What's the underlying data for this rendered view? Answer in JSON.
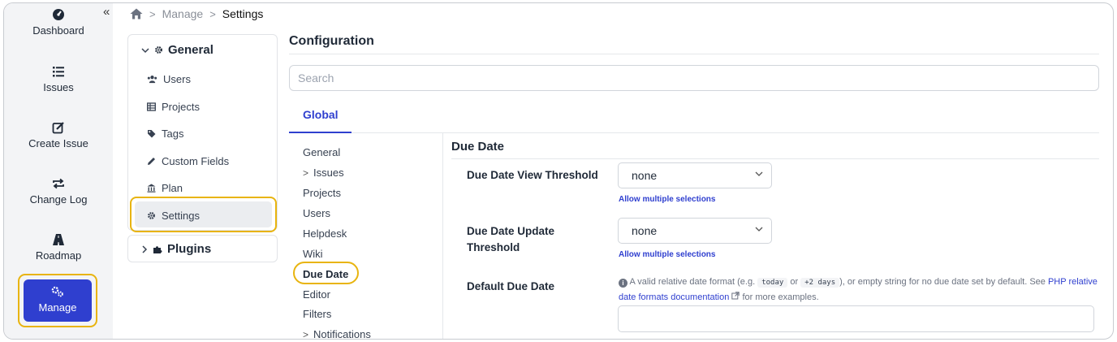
{
  "rail": {
    "collapse_icon": "«",
    "items": [
      {
        "label": "Dashboard",
        "icon": "dashboard-icon"
      },
      {
        "label": "Issues",
        "icon": "list-icon"
      },
      {
        "label": "Create Issue",
        "icon": "edit-icon"
      },
      {
        "label": "Change Log",
        "icon": "repeat-icon"
      },
      {
        "label": "Roadmap",
        "icon": "road-icon"
      },
      {
        "label": "Manage",
        "icon": "cogs-icon"
      }
    ]
  },
  "breadcrumb": {
    "home_icon": "home-icon",
    "items": [
      "Manage",
      "Settings"
    ]
  },
  "settings_nav": {
    "general_label": "General",
    "items": [
      {
        "label": "Users",
        "icon": "users-icon"
      },
      {
        "label": "Projects",
        "icon": "table-icon"
      },
      {
        "label": "Tags",
        "icon": "tags-icon"
      },
      {
        "label": "Custom Fields",
        "icon": "pencil-icon"
      },
      {
        "label": "Plan",
        "icon": "bank-icon"
      },
      {
        "label": "Settings",
        "icon": "gear-icon"
      }
    ],
    "plugins_label": "Plugins"
  },
  "config": {
    "title": "Configuration",
    "search_placeholder": "Search",
    "tab_label": "Global",
    "subnav": [
      "General",
      "Issues",
      "Projects",
      "Users",
      "Helpdesk",
      "Wiki",
      "Due Date",
      "Editor",
      "Filters",
      "Notifications"
    ],
    "section_title": "Due Date",
    "fields": {
      "view_threshold_label": "Due Date View Threshold",
      "view_threshold_value": "none",
      "update_threshold_label_1": "Due Date Update",
      "update_threshold_label_2": "Threshold",
      "update_threshold_value": "none",
      "allow_multiple": "Allow multiple selections",
      "default_label": "Default Due Date",
      "help_prefix": "A valid relative date format (e.g.",
      "help_code1": "today",
      "help_or": "or",
      "help_code2": "+2 days",
      "help_mid": "), or empty string for no due date set by default. See",
      "help_link": "PHP relative date formats documentation",
      "help_suffix": "for more examples.",
      "default_value": ""
    }
  },
  "colors": {
    "accent": "#2f3fcf",
    "highlight": "#e8b40f"
  }
}
